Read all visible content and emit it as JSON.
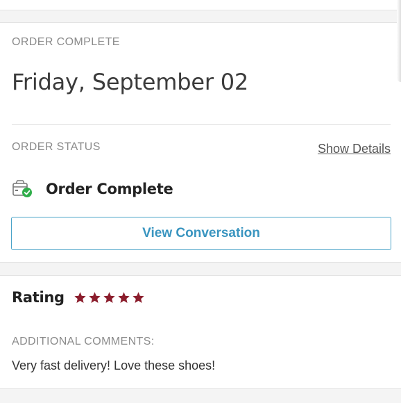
{
  "order": {
    "section_label": "ORDER COMPLETE",
    "date": "Friday, September 02",
    "status_label": "ORDER STATUS",
    "show_details_label": "Show Details",
    "status_text": "Order Complete",
    "status_icon": "package-check-icon",
    "view_conversation_label": "View Conversation"
  },
  "rating": {
    "label": "Rating",
    "stars": 5,
    "max_stars": 5,
    "star_color": "#8b1d2c",
    "comments_label": "ADDITIONAL COMMENTS:",
    "comment_text": "Very fast delivery! Love these shoes!"
  },
  "colors": {
    "accent": "#3a95c0",
    "success": "#2fae4a",
    "star": "#8b1d2c"
  }
}
